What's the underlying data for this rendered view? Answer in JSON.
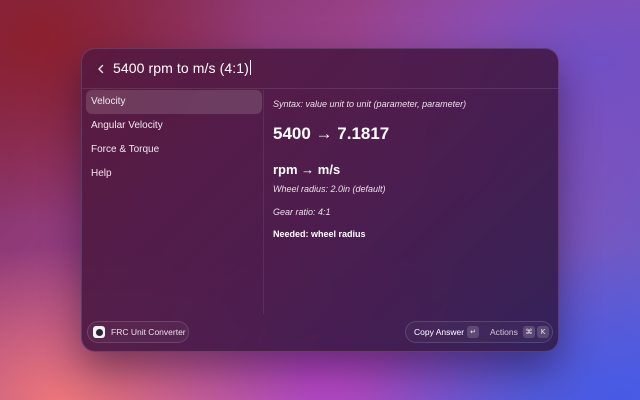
{
  "search": {
    "query": "5400 rpm to m/s (4:1)",
    "back_icon": "chevron-left-icon"
  },
  "sidebar": {
    "items": [
      {
        "label": "Velocity",
        "active": true
      },
      {
        "label": "Angular Velocity",
        "active": false
      },
      {
        "label": "Force & Torque",
        "active": false
      },
      {
        "label": "Help",
        "active": false
      }
    ]
  },
  "detail": {
    "syntax": "Syntax: value unit to unit (parameter, parameter)",
    "result": "5400 → 7.1817",
    "units": "rpm → m/s",
    "wheel_radius": "Wheel radius: 2.0in (default)",
    "gear_ratio": "Gear ratio: 4:1",
    "needed": "Needed: wheel radius"
  },
  "footer": {
    "app_name": "FRC Unit Converter",
    "copy_label": "Copy Answer",
    "return_key": "↵",
    "actions_label": "Actions",
    "cmd_key": "⌘",
    "k_key": "K"
  }
}
